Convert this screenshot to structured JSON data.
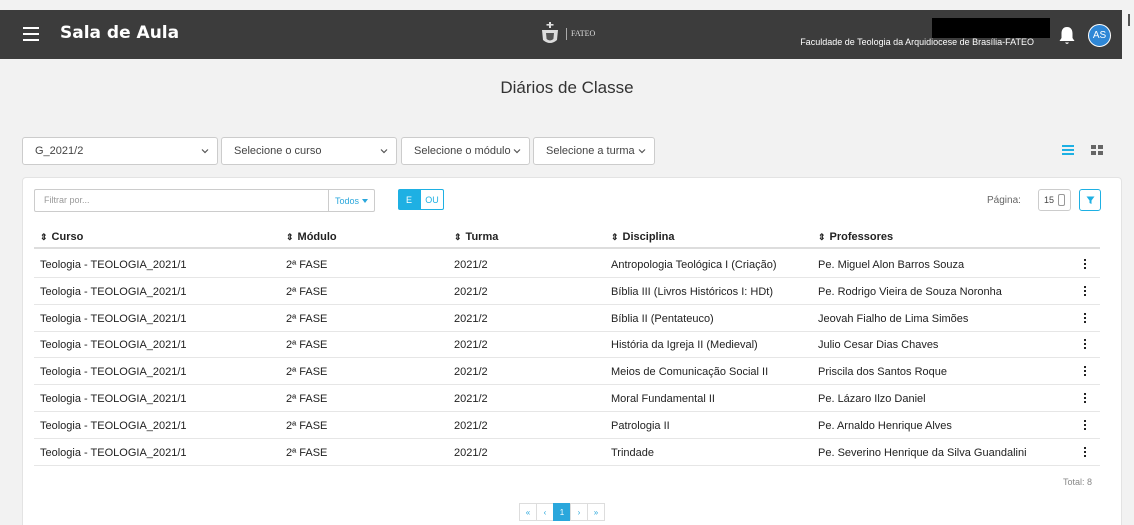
{
  "header": {
    "app_title": "Sala de Aula",
    "logo_text": "FATEO",
    "institution": "Faculdade de Teologia da Arquidiocese de Brasília-FATEO",
    "avatar_initials": "AS"
  },
  "page_title": "Diários de Classe",
  "filters": {
    "period": "G_2021/2",
    "course": "Selecione o curso",
    "module": "Selecione o módulo",
    "class": "Selecione a turma"
  },
  "toolbar": {
    "filter_placeholder": "Filtrar por...",
    "todos_label": "Todos",
    "e_label": "E",
    "ou_label": "OU",
    "page_label": "Página:",
    "page_size": "15"
  },
  "table": {
    "columns": [
      "Curso",
      "Módulo",
      "Turma",
      "Disciplina",
      "Professores"
    ],
    "rows": [
      [
        "Teologia - TEOLOGIA_2021/1",
        "2ª FASE",
        "2021/2",
        "Antropologia Teológica I (Criação)",
        "Pe. Miguel Alon Barros Souza"
      ],
      [
        "Teologia - TEOLOGIA_2021/1",
        "2ª FASE",
        "2021/2",
        "Bíblia III (Livros Históricos I: HDt)",
        "Pe. Rodrigo Vieira de Souza Noronha"
      ],
      [
        "Teologia - TEOLOGIA_2021/1",
        "2ª FASE",
        "2021/2",
        "Bíblia II (Pentateuco)",
        "Jeovah Fialho de Lima Simões"
      ],
      [
        "Teologia - TEOLOGIA_2021/1",
        "2ª FASE",
        "2021/2",
        "História da Igreja II (Medieval)",
        "Julio Cesar Dias Chaves"
      ],
      [
        "Teologia - TEOLOGIA_2021/1",
        "2ª FASE",
        "2021/2",
        "Meios de Comunicação Social II",
        "Priscila dos Santos Roque"
      ],
      [
        "Teologia - TEOLOGIA_2021/1",
        "2ª FASE",
        "2021/2",
        "Moral Fundamental II",
        "Pe. Lázaro Ilzo Daniel"
      ],
      [
        "Teologia - TEOLOGIA_2021/1",
        "2ª FASE",
        "2021/2",
        "Patrologia II",
        "Pe. Arnaldo Henrique Alves"
      ],
      [
        "Teologia - TEOLOGIA_2021/1",
        "2ª FASE",
        "2021/2",
        "Trindade",
        "Pe. Severino Henrique da Silva Guandalini"
      ]
    ],
    "total": "Total: 8"
  },
  "pagination": {
    "first": "«",
    "prev": "‹",
    "current": "1",
    "next": "›",
    "last": "»"
  },
  "colors": {
    "topbar": "#3c3c3c",
    "accent": "#1eb0e3",
    "avatar": "#2f87d6"
  }
}
